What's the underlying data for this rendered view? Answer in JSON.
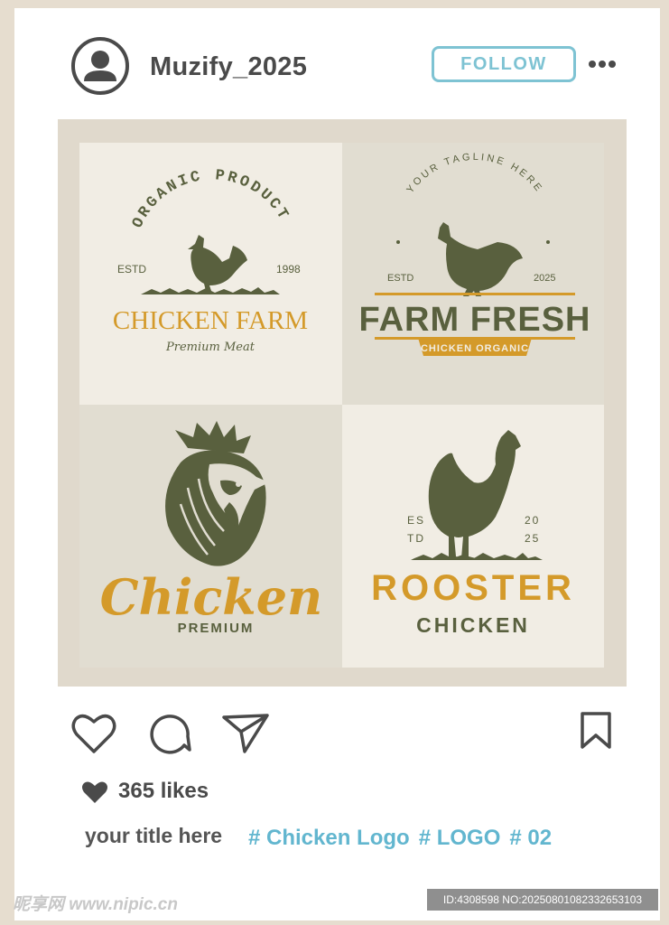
{
  "post": {
    "username": "Muzify_2025",
    "follow_label": "FOLLOW",
    "likes_text": "365 likes",
    "caption": "your title here",
    "hashtags": [
      "# Chicken Logo",
      "# LOGO",
      "# 02"
    ]
  },
  "logos": {
    "farm": {
      "arc": "ORGANIC PRODUCT",
      "estd": "ESTD",
      "year": "1998",
      "title": "CHICKEN FARM",
      "sub": "Premium Meat"
    },
    "fresh": {
      "arc": "YOUR TAGLINE HERE",
      "estd": "ESTD",
      "year": "2025",
      "title": "FARM FRESH",
      "ribbon": "CHICKEN ORGANIC"
    },
    "chicken": {
      "script": "Chicken",
      "sub": "PREMIUM"
    },
    "rooster": {
      "es": "ES",
      "td": "TD",
      "y1": "20",
      "y2": "25",
      "title": "ROOSTER",
      "sub": "CHICKEN"
    }
  },
  "watermark": {
    "site": "昵享网 www.nipic.cn",
    "id": "ID:4308598 NO:20250801082332653103"
  },
  "colors": {
    "accent": "#7ec3d3",
    "hashtag": "#62b6cf",
    "logo_green": "#59603e",
    "logo_gold": "#d49a2a",
    "frame": "#e6ddcf"
  },
  "icons": [
    "user-icon",
    "more-icon",
    "heart-icon",
    "comment-icon",
    "share-icon",
    "bookmark-icon",
    "heart-filled-icon"
  ]
}
